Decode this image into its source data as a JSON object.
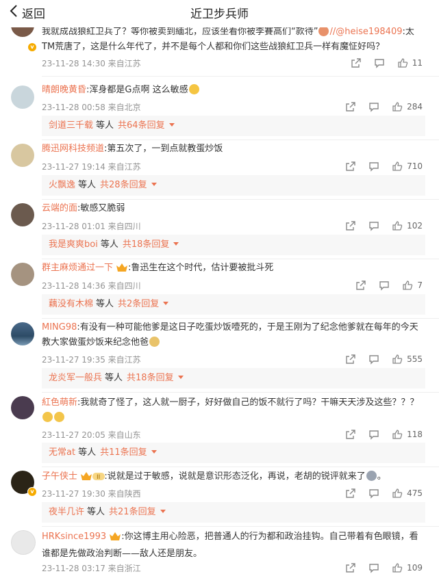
{
  "header": {
    "back_label": "返回",
    "title": "近卫步兵师"
  },
  "comments": [
    {
      "line1_pre": "我就成战狼紅卫兵了？等你被卖到緬北，应该坐看你被李賽高们“款待”",
      "line1_mention": "//@heise198409",
      "line1_post": ":太",
      "line2": "TM荒唐了，这是什么年代了，并不是每个人都和你们这些战狼紅卫兵一样有魔怔好吗？",
      "time": "23-11-28 14:30 来自江苏",
      "likes": "11"
    },
    {
      "user": "晴朗晚黄昏",
      "text": ":浑身都是G点啊 这么敏感",
      "time": "23-11-28 00:58 来自北京",
      "likes": "284",
      "reply_user": "剑道三千载",
      "reply_mid": "等人",
      "reply_total": "共64条回复"
    },
    {
      "user": "腾迅网科技频道",
      "text": ":第五次了，一到点就教蛋炒饭",
      "time": "23-11-27 19:14 来自江苏",
      "likes": "710",
      "reply_user": "火飘逸",
      "reply_mid": "等人",
      "reply_total": "共28条回复"
    },
    {
      "user": "云端的面",
      "text": ":敏感又脆弱",
      "time": "23-11-28 01:01 来自四川",
      "likes": "102",
      "reply_user": "我是爽爽boi",
      "reply_mid": "等人",
      "reply_total": "共18条回复"
    },
    {
      "user": "群主麻烦通过一下",
      "text": ":鲁迅生在这个时代，估计要被批斗死",
      "time": "23-11-28 14:36 来自四川",
      "likes": "7",
      "reply_user": "藕没有木棉",
      "reply_mid": "等人",
      "reply_total": "共2条回复"
    },
    {
      "user": "MING98",
      "text1": ":有没有一种可能他爹是这日子吃蛋炒饭噎死的，于是王刚为了纪念他爹就在每年的今天",
      "text2": "教大家做蛋炒饭来纪念他爸",
      "time": "23-11-27 19:35 来自江苏",
      "likes": "555",
      "reply_user": "龙炎军一般兵",
      "reply_mid": "等人",
      "reply_total": "共18条回复"
    },
    {
      "user": "紅色萌新",
      "text1": ":我就奇了怪了，这人就一厨子，好好做自己的饭不就行了吗？干嘛天天涉及这些？？？",
      "time": "23-11-27 20:05 来自山东",
      "likes": "118",
      "reply_user": "无常at",
      "reply_mid": "等人",
      "reply_total": "共11条回复"
    },
    {
      "user": "子午侠士",
      "badge": "II",
      "text": ":说就是过于敏感，说就是意识形态泛化，再说，老胡的锐评就来了",
      "text_end": "。",
      "time": "23-11-27 19:30 来自陕西",
      "likes": "475",
      "reply_user": "夜半几许",
      "reply_mid": "等人",
      "reply_total": "共21条回复"
    },
    {
      "user": "HRKsince1993",
      "text1": ":你这博主用心险恶，把普通人的行为都和政治挂钩。自己带着有色眼镜，看",
      "text2": "谁都是先做政治判断——敌人还是朋友。",
      "time": "23-11-28 03:17 来自浙江",
      "likes": "109"
    }
  ]
}
